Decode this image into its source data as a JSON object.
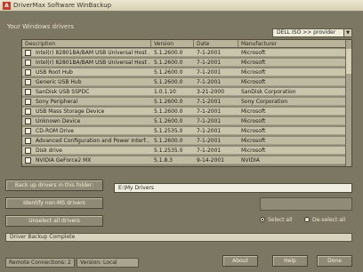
{
  "window": {
    "title": "DriverMax Software WinBackup",
    "app_icon": "A"
  },
  "subtitle": "Your Windows drivers",
  "sort_dropdown": {
    "value": "DELL ISO >> provider"
  },
  "table": {
    "columns": [
      "Description",
      "Version",
      "Date",
      "Manufacturer"
    ],
    "rows": [
      [
        "Intel(r) 82801BA/BAM USB Universal Host ...",
        "5.1.2600.0",
        "7-1-2001",
        "Microsoft"
      ],
      [
        "Intel(r) 82801BA/BAM USB Universal Host ...",
        "5.1.2600.0",
        "7-1-2001",
        "Microsoft"
      ],
      [
        "USB Root Hub",
        "5.1.2600.0",
        "7-1-2001",
        "Microsoft"
      ],
      [
        "Generic USB Hub",
        "5.1.2600.0",
        "7-1-2001",
        "Microsoft"
      ],
      [
        "SanDisk USB SSPDC",
        "1.0.1.10",
        "3-21-2000",
        "SanDisk Corporation"
      ],
      [
        "Sony Peripheral",
        "5.1.2600.0",
        "7-1-2001",
        "Sony Corporation"
      ],
      [
        "USB Mass Storage Device",
        "5.1.2600.0",
        "7-1-2001",
        "Microsoft"
      ],
      [
        "Unknown Device",
        "5.1.2600.0",
        "7-1-2001",
        "Microsoft"
      ],
      [
        "CD-ROM Drive",
        "5.1.2535.0",
        "7-1-2001",
        "Microsoft"
      ],
      [
        "Advanced Configuration and Power Interf...",
        "5.1.2600.0",
        "7-1-2001",
        "Microsoft"
      ],
      [
        "Disk drive",
        "5.1.2535.0",
        "7-1-2001",
        "Microsoft"
      ],
      [
        "NVIDIA GeForce2 MX",
        "5.1.8.3",
        "9-14-2001",
        "NVIDIA"
      ]
    ]
  },
  "buttons": {
    "backup": "Back up drivers in this folder:",
    "identify": "Identify non-MS drivers",
    "unselect": "Unselect all drivers",
    "about": "About",
    "help": "Help",
    "done": "Done"
  },
  "backup_path": "E:\\My Drivers",
  "radios": {
    "select_all": "Select all",
    "deselect_all": "De-select all"
  },
  "status": "Driver Backup Complete",
  "footer": {
    "connections": "Remote Connections: 2",
    "version": "Version: Local"
  },
  "icons": {
    "dropdown": "chevron-down-icon",
    "checkbox": "checkbox-icon"
  }
}
